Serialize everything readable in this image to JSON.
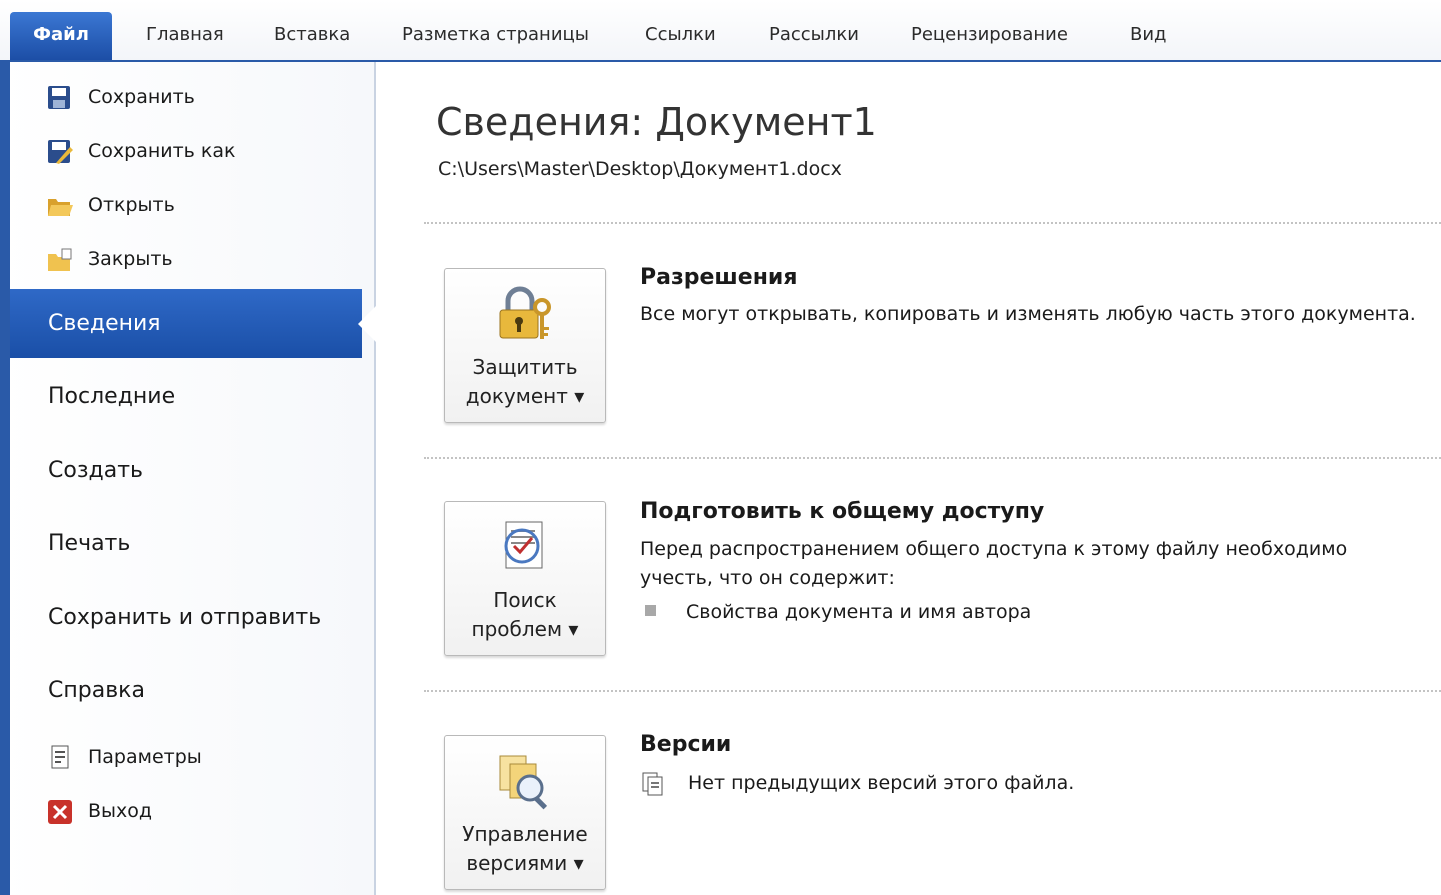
{
  "ribbon": {
    "tabs": [
      {
        "label": "Файл"
      },
      {
        "label": "Главная"
      },
      {
        "label": "Вставка"
      },
      {
        "label": "Разметка страницы"
      },
      {
        "label": "Ссылки"
      },
      {
        "label": "Рассылки"
      },
      {
        "label": "Рецензирование"
      },
      {
        "label": "Вид"
      }
    ]
  },
  "nav": {
    "commands": [
      {
        "label": "Сохранить",
        "icon": "save-icon"
      },
      {
        "label": "Сохранить как",
        "icon": "save-as-icon"
      },
      {
        "label": "Открыть",
        "icon": "open-folder-icon"
      },
      {
        "label": "Закрыть",
        "icon": "close-folder-icon"
      }
    ],
    "selected": "Сведения",
    "items": [
      "Последние",
      "Создать",
      "Печать",
      "Сохранить и отправить",
      "Справка"
    ],
    "bottom": [
      {
        "label": "Параметры",
        "icon": "options-icon"
      },
      {
        "label": "Выход",
        "icon": "exit-icon"
      }
    ]
  },
  "info": {
    "title": "Сведения: Документ1",
    "path": "C:\\Users\\Master\\Desktop\\Документ1.docx",
    "sections": [
      {
        "button_line1": "Защитить",
        "button_line2": "документ ▾",
        "icon": "lock-key-icon",
        "heading": "Разрешения",
        "text": "Все могут открывать, копировать и изменять любую часть этого документа."
      },
      {
        "button_line1": "Поиск",
        "button_line2": "проблем ▾",
        "icon": "inspect-document-icon",
        "heading": "Подготовить к общему доступу",
        "text_line1": "Перед распространением общего доступа к этому файлу необходимо",
        "text_line2": "учесть, что он содержит:",
        "bullet": "Свойства документа и имя автора"
      },
      {
        "button_line1": "Управление",
        "button_line2": "версиями ▾",
        "icon": "manage-versions-icon",
        "heading": "Версии",
        "text": "Нет предыдущих версий этого файла.",
        "text_icon": "versions-doc-icon"
      }
    ]
  },
  "colors": {
    "accent": "#2a5aa8",
    "selected_bg": "#1f56b0"
  }
}
